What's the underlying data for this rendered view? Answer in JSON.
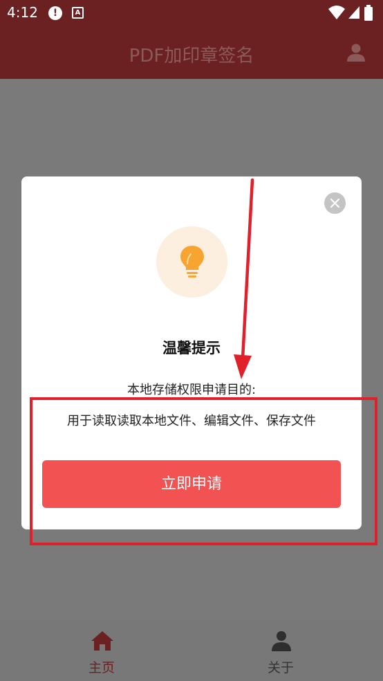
{
  "status_bar": {
    "time": "4:12",
    "alert_glyph": "!",
    "accessibility_glyph": "A"
  },
  "app_bar": {
    "title": "PDF加印章签名",
    "user_icon": "user-icon"
  },
  "dialog": {
    "title": "温馨提示",
    "subtitle": "本地存储权限申请目的:",
    "description": "用于读取读取本地文件、编辑文件、保存文件",
    "apply_button": "立即申请",
    "icon": "lightbulb-icon",
    "close_icon": "close-icon"
  },
  "tab_bar": {
    "tabs": [
      {
        "label": "主页",
        "icon": "home-icon",
        "active": true
      },
      {
        "label": "关于",
        "icon": "person-icon",
        "active": false
      }
    ]
  },
  "colors": {
    "app_bar": "#6b2121",
    "accent": "#f25252",
    "annotation": "#e0202a",
    "bulb": "#f7a531"
  }
}
